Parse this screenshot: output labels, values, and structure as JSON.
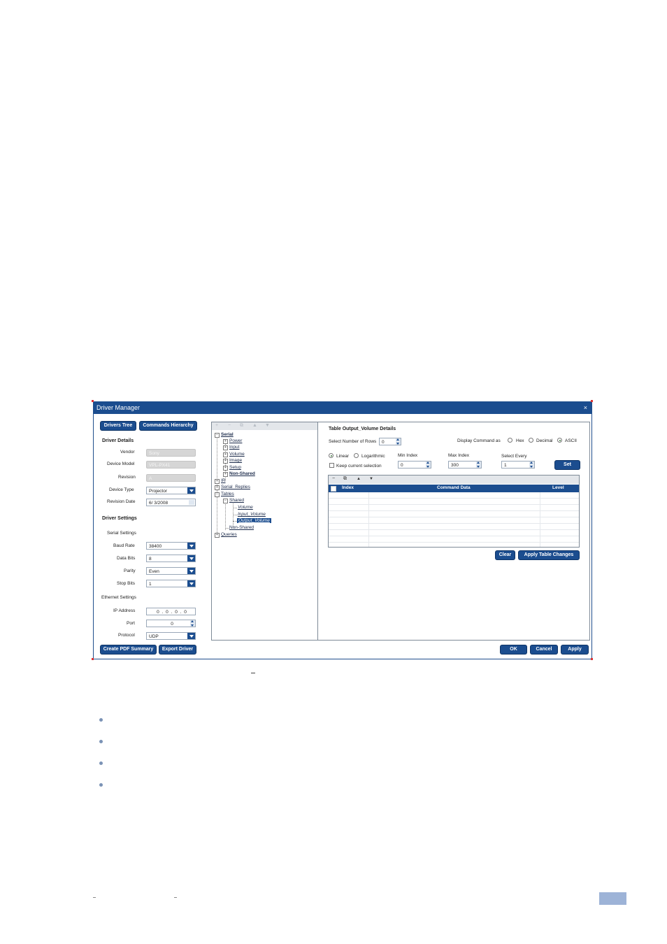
{
  "window": {
    "title": "Driver Manager",
    "close_glyph": "×"
  },
  "left_panel": {
    "tabs": [
      "Drivers Tree",
      "Commands Hierarchy"
    ],
    "driver_details_heading": "Driver Details",
    "vendor_label": "Vendor",
    "vendor_value": "Sony",
    "device_model_label": "Device Model",
    "device_model_value": "VPL-PX41",
    "revision_label": "Revision",
    "revision_value": "A",
    "device_type_label": "Device Type",
    "device_type_value": "Projector",
    "revision_date_label": "Revision Date",
    "revision_date_value": "6/ 3/2008",
    "driver_settings_heading": "Driver Settings",
    "serial_settings_label": "Serial Settings",
    "baud_rate_label": "Baud Rate",
    "baud_rate_value": "38400",
    "data_bits_label": "Data Bits",
    "data_bits_value": "8",
    "parity_label": "Parity",
    "parity_value": "Even",
    "stop_bits_label": "Stop Bits",
    "stop_bits_value": "1",
    "ethernet_settings_label": "Ethernet Settings",
    "ip_address_label": "IP Address",
    "ip_address_value": "0 . 0 . 0 . 0",
    "port_label": "Port",
    "port_value": "0",
    "protocol_label": "Protocol",
    "protocol_value": "UDP",
    "create_pdf_label": "Create PDF Summary",
    "export_driver_label": "Export Driver"
  },
  "tree": {
    "toolbar_icons": [
      "add-icon",
      "remove-icon",
      "copy-icon",
      "move-up-icon",
      "move-down-icon"
    ],
    "nodes": {
      "serial": "Serial",
      "power": "Power",
      "input": "Input",
      "volume": "Volume",
      "image": "Image",
      "setup": "Setup",
      "non_shared_bold": "Non-Shared",
      "ir": "IR",
      "serial_replies": "Serial_Replies",
      "tables": "Tables",
      "shared": "Shared",
      "t_volume": "Volume",
      "t_input_volume": "Input_Volume",
      "t_output_volume": "Output_Volume",
      "t_non_shared": "Non-Shared",
      "queries": "Queries"
    }
  },
  "details": {
    "heading": "Table Output_Volume Details",
    "select_rows_label": "Select Number of Rows",
    "select_rows_value": "0",
    "display_command_label": "Display Command as",
    "display_options": [
      "Hex",
      "Decimal",
      "ASCII"
    ],
    "display_selected": "ASCII",
    "scale_options": [
      "Linear",
      "Logarithmic"
    ],
    "scale_selected": "Linear",
    "keep_selection_label": "Keep current selection",
    "min_index_label": "Min Index",
    "min_index_value": "0",
    "max_index_label": "Max Index",
    "max_index_value": "300",
    "select_every_label": "Select Every",
    "select_every_value": "1",
    "set_label": "Set",
    "grid_columns": [
      "Index",
      "Command Data",
      "Level"
    ],
    "clear_label": "Clear",
    "apply_table_label": "Apply Table Changes"
  },
  "footer_buttons": {
    "ok": "OK",
    "cancel": "Cancel",
    "apply": "Apply"
  },
  "colors": {
    "accent": "#1b4d8f",
    "bullet": "#7b93b6",
    "page_badge": "#9db3d7"
  }
}
